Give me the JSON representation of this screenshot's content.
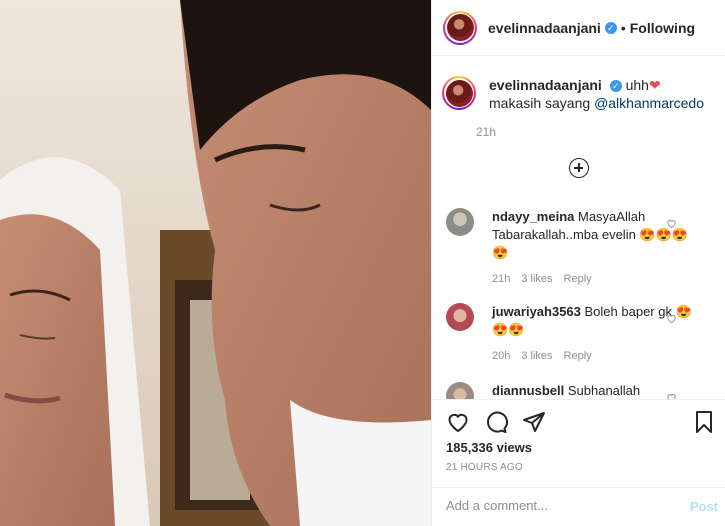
{
  "post": {
    "username": "evelinnadaanjani",
    "verified": true,
    "follow_status": "Following",
    "separator": "•"
  },
  "caption": {
    "username": "evelinnadaanjani",
    "text_before": "uhh",
    "heart": "❤",
    "text_after": " makasih sayang ",
    "mention": "@alkhanmarcedo",
    "time": "21h"
  },
  "comments": [
    {
      "username": "ndayy_meina",
      "text": "MasyaAllah Tabarakallah..mba evelin 😍😍😍😍",
      "time": "21h",
      "likes": "3 likes",
      "reply": "Reply"
    },
    {
      "username": "juwariyah3563",
      "text": "Boleh baper gk 😍😍😍",
      "time": "20h",
      "likes": "3 likes",
      "reply": "Reply"
    },
    {
      "username": "diannusbell",
      "text": "Subhanallah"
    }
  ],
  "stats": {
    "views": "185,336 views",
    "time_ago": "21 HOURS AGO"
  },
  "composer": {
    "placeholder": "Add a comment...",
    "post_label": "Post"
  },
  "icons": [
    "heart-icon",
    "comment-icon",
    "share-icon",
    "bookmark-icon",
    "plus-circle-icon",
    "verified-icon"
  ],
  "colors": {
    "link": "#00376b",
    "verified": "#3897f0",
    "heart": "#ed4956",
    "post_disabled": "#b2dffc",
    "muted": "#8e8e8e"
  }
}
